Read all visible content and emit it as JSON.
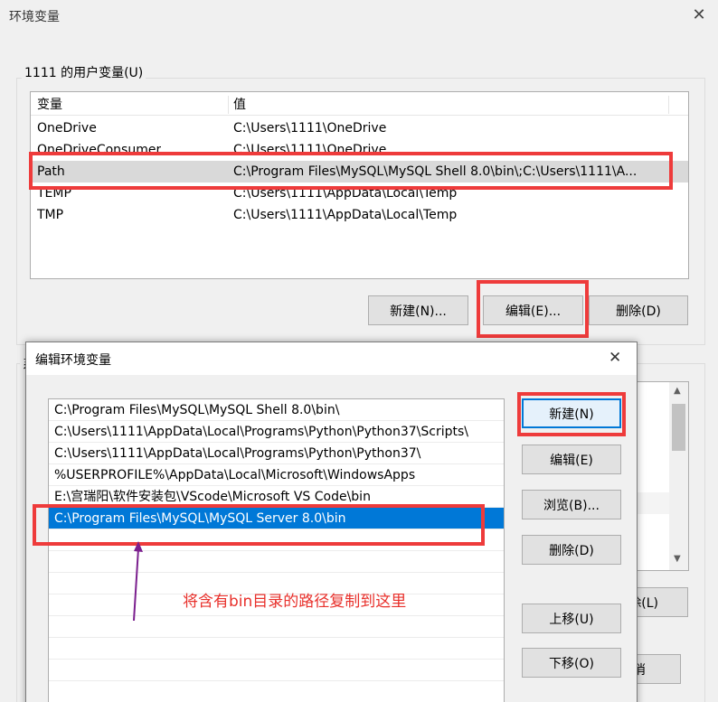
{
  "window": {
    "title": "环境变量",
    "close_glyph": "✕"
  },
  "user_vars": {
    "group_label": "1111 的用户变量(U)",
    "col_name": "变量",
    "col_value": "值",
    "rows": [
      {
        "name": "OneDrive",
        "value": "C:\\Users\\1111\\OneDrive"
      },
      {
        "name": "OneDriveConsumer",
        "value": "C:\\Users\\1111\\OneDrive"
      },
      {
        "name": "Path",
        "value": "C:\\Program Files\\MySQL\\MySQL Shell 8.0\\bin\\;C:\\Users\\1111\\A..."
      },
      {
        "name": "TEMP",
        "value": "C:\\Users\\1111\\AppData\\Local\\Temp"
      },
      {
        "name": "TMP",
        "value": "C:\\Users\\1111\\AppData\\Local\\Temp"
      }
    ],
    "buttons": {
      "new": "新建(N)...",
      "edit": "编辑(E)...",
      "delete": "删除(D)"
    }
  },
  "system_vars": {
    "group_label_partial": "系",
    "delete_partial": "除(L)",
    "cancel_partial": "消"
  },
  "dialog": {
    "title": "编辑环境变量",
    "close_glyph": "✕",
    "paths": [
      "C:\\Program Files\\MySQL\\MySQL Shell 8.0\\bin\\",
      "C:\\Users\\1111\\AppData\\Local\\Programs\\Python\\Python37\\Scripts\\",
      "C:\\Users\\1111\\AppData\\Local\\Programs\\Python\\Python37\\",
      "%USERPROFILE%\\AppData\\Local\\Microsoft\\WindowsApps",
      "E:\\宫瑞阳\\软件安装包\\VScode\\Microsoft VS Code\\bin",
      "C:\\Program Files\\MySQL\\MySQL Server 8.0\\bin"
    ],
    "buttons": {
      "new": "新建(N)",
      "edit": "编辑(E)",
      "browse": "浏览(B)...",
      "delete": "删除(D)",
      "move_up": "上移(U)",
      "move_down": "下移(O)"
    }
  },
  "annotation": {
    "text": "将含有bin目录的路径复制到这里",
    "color": "#e8302b",
    "arrow_color": "#7b1f8e"
  },
  "colors": {
    "highlight_box": "#ee3b3b",
    "selection": "#0078d7"
  }
}
